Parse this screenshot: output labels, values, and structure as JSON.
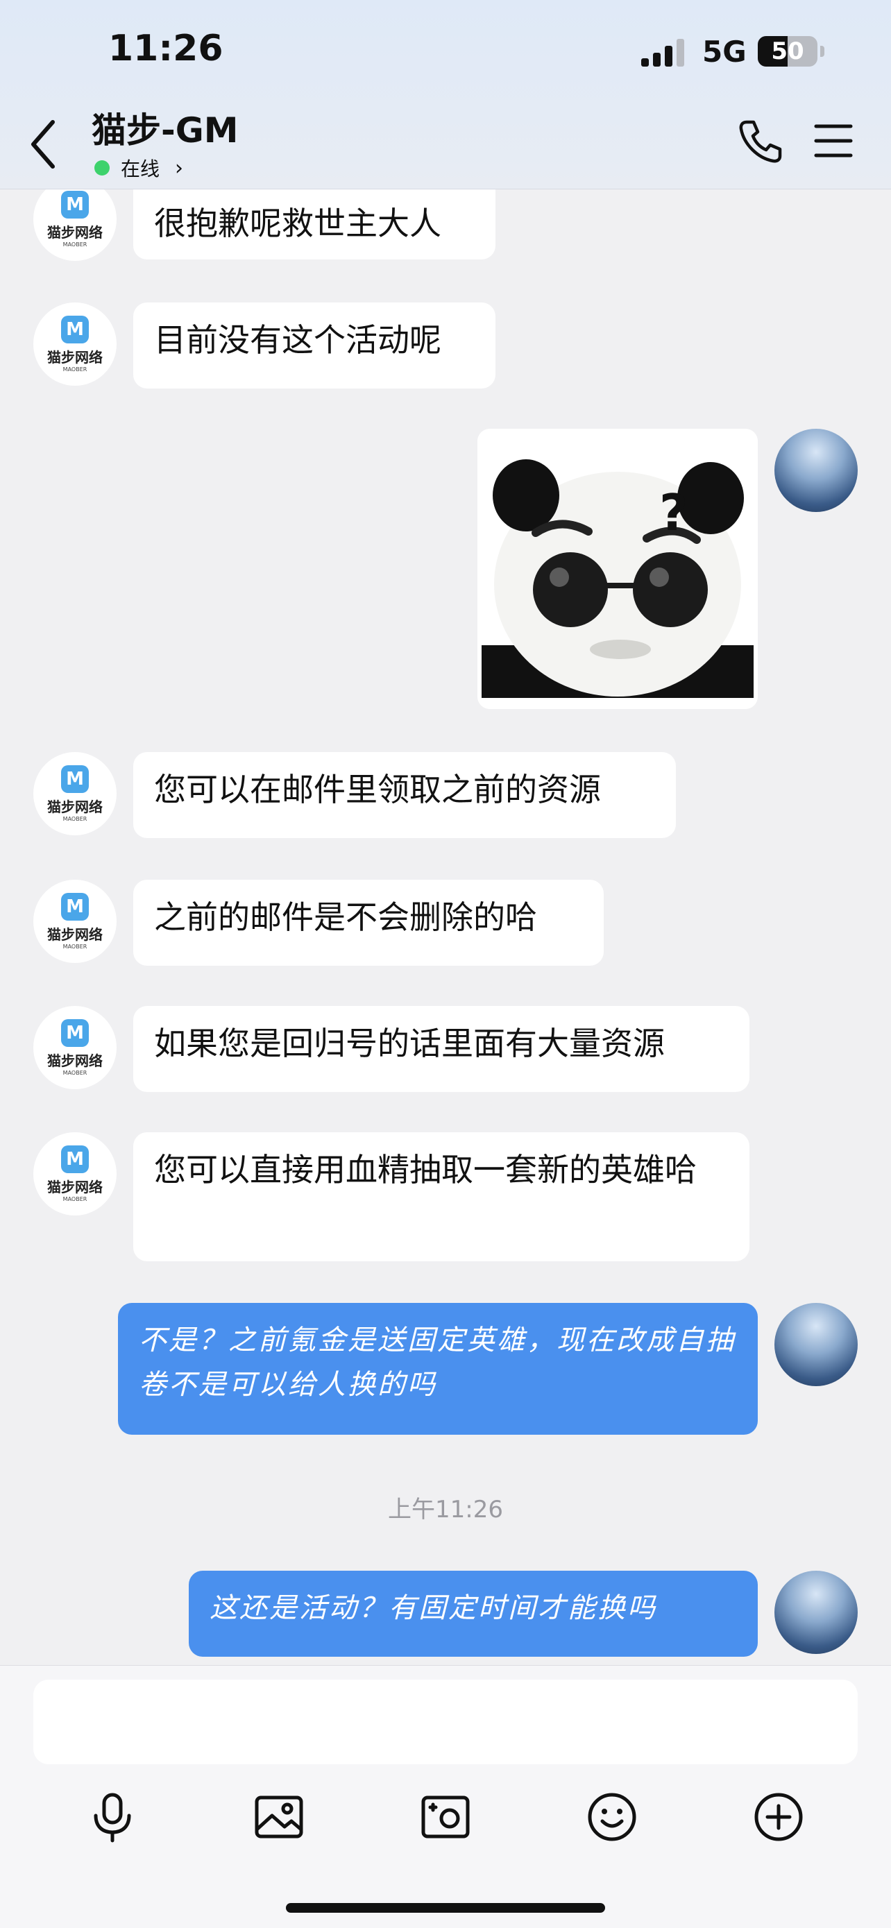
{
  "status_bar": {
    "time": "11:26",
    "network": "5G",
    "battery": "50",
    "battery_level": 0.5
  },
  "header": {
    "contact_name": "猫步-GM",
    "status_text": "在线",
    "status_color": "#3dd26c"
  },
  "icons": {
    "back": "chevron-left-icon",
    "call": "phone-icon",
    "menu": "hamburger-menu-icon",
    "voice": "microphone-icon",
    "photo": "image-icon",
    "camera": "camera-icon",
    "emoji": "emoji-icon",
    "more": "plus-circle-icon"
  },
  "gm_avatar": {
    "brand": "猫步网络",
    "brand_sub": "MAOBER",
    "logo_letter": "M"
  },
  "messages": [
    {
      "sender": "gm",
      "text": "很抱歉呢救世主大人"
    },
    {
      "sender": "gm",
      "text": "目前没有这个活动呢"
    },
    {
      "sender": "me",
      "type": "sticker",
      "caption": "?"
    },
    {
      "sender": "gm",
      "text": "您可以在邮件里领取之前的资源"
    },
    {
      "sender": "gm",
      "text": "之前的邮件是不会删除的哈"
    },
    {
      "sender": "gm",
      "text": "如果您是回归号的话里面有大量资源"
    },
    {
      "sender": "gm",
      "text": "您可以直接用血精抽取一套新的英雄哈"
    },
    {
      "sender": "me",
      "text": "不是？之前氪金是送固定英雄，现在改成自抽卷不是可以给人换的吗"
    },
    {
      "sender": "me",
      "text": "这还是活动？有固定时间才能换吗"
    }
  ],
  "timestamp": "上午11:26",
  "colors": {
    "my_bubble": "#4a90ee",
    "other_bubble": "#ffffff",
    "chat_bg": "#f0f0f2"
  }
}
